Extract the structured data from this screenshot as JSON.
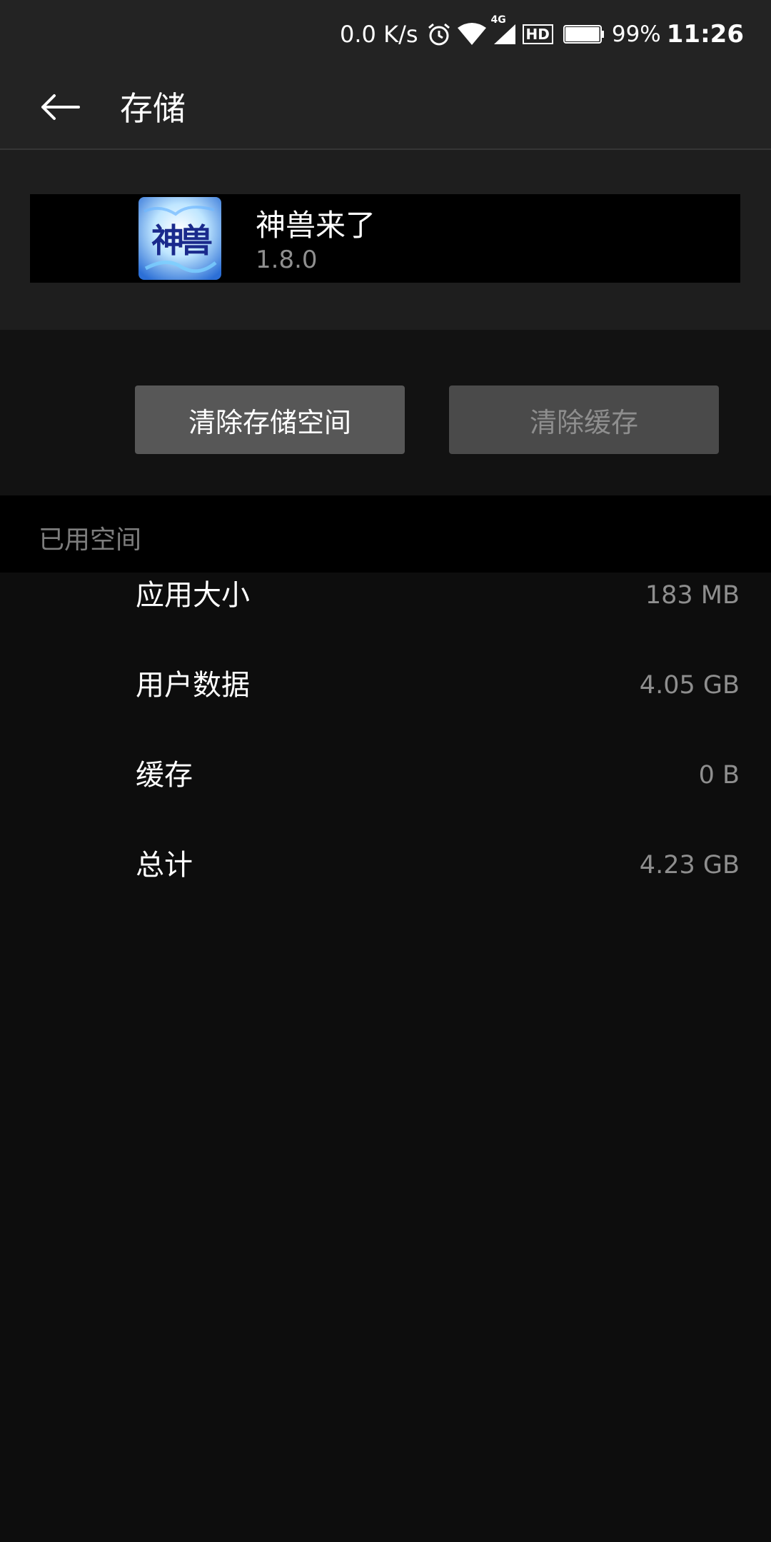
{
  "status_bar": {
    "net_speed": "0.0 K/s",
    "network_type": "4G",
    "hd_label": "HD",
    "battery_percent": "99%",
    "battery_level": 0.99,
    "time": "11:26"
  },
  "app_bar": {
    "title": "存储"
  },
  "app_info": {
    "name": "神兽来了",
    "version": "1.8.0",
    "icon_text": "神兽"
  },
  "actions": {
    "clear_storage": "清除存储空间",
    "clear_cache": "清除缓存"
  },
  "used_space": {
    "header": "已用空间",
    "rows": [
      {
        "label": "应用大小",
        "value": "183 MB"
      },
      {
        "label": "用户数据",
        "value": "4.05 GB"
      },
      {
        "label": "缓存",
        "value": "0 B"
      },
      {
        "label": "总计",
        "value": "4.23 GB"
      }
    ]
  },
  "colors": {
    "background": "#0d0d0d",
    "bar": "#232323",
    "primary_button": "#575757",
    "disabled_button": "#4a4a4a"
  },
  "icons": [
    "alarm-icon",
    "wifi-icon",
    "signal-icon",
    "hd-icon",
    "battery-icon",
    "back-arrow-icon",
    "app-icon"
  ]
}
